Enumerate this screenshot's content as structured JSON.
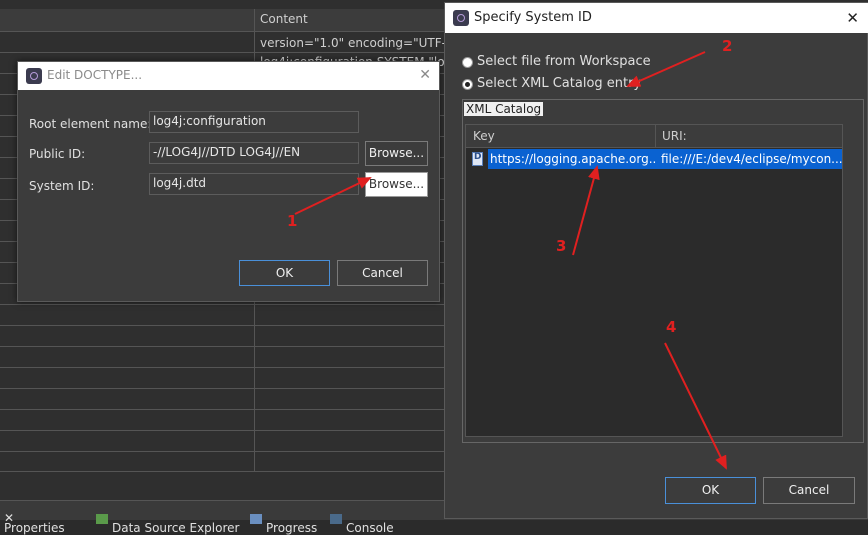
{
  "background": {
    "content_header": "Content",
    "row1": "version=\"1.0\" encoding=\"UTF-8\"",
    "row2": "log4j:configuration SYSTEM \"lo"
  },
  "edit_doctype": {
    "title": "Edit DOCTYPE...",
    "root_label": "Root element name:",
    "root_value": "log4j:configuration",
    "public_label": "Public ID:",
    "public_value": "-//LOG4J//DTD LOG4J//EN",
    "system_label": "System ID:",
    "system_value": "log4j.dtd",
    "browse_label": "Browse...",
    "ok_label": "OK",
    "cancel_label": "Cancel"
  },
  "specify_system_id": {
    "title": "Specify System ID",
    "radio_workspace": "Select file from Workspace",
    "radio_catalog": "Select XML Catalog entry",
    "selected_option": "Select XML Catalog entry",
    "group_label": "XML Catalog",
    "columns": [
      "Key",
      "URI:"
    ],
    "rows": [
      {
        "key": "https://logging.apache.org...",
        "uri": "file:///E:/dev4/eclipse/mycon..."
      }
    ],
    "ok_label": "OK",
    "cancel_label": "Cancel"
  },
  "bottom_tabs": [
    "Properties",
    "Data Source Explorer",
    "Progress",
    "Console"
  ],
  "annotations": [
    "1",
    "2",
    "3",
    "4"
  ],
  "colors": {
    "selection": "#0a62d1",
    "annotation": "#e02020",
    "focus_border": "#4a90d9"
  }
}
